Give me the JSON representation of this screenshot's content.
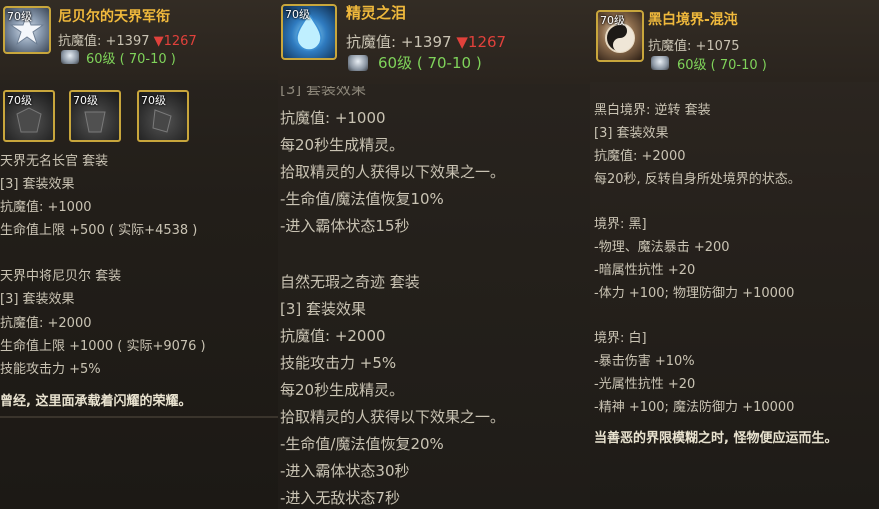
{
  "tooltips": [
    {
      "item_level": "70级",
      "name": "尼贝尔的天界军衔",
      "stat_line": "抗魔值: +1397",
      "stat_down": "▼1267",
      "req": "60级 ( 70-10 )",
      "set_slots": [
        "70级",
        "70级",
        "70级"
      ],
      "lines": [
        "天界无名长官  套装",
        "[3] 套装效果",
        "抗魔值: +1000",
        "生命值上限 +500 ( 实际+4538 )",
        "",
        "天界中将尼贝尔  套装",
        "[3] 套装效果",
        "抗魔值: +2000",
        "生命值上限 +1000 ( 实际+9076 )",
        "技能攻击力 +5%"
      ],
      "flavor": "曾经, 这里面承载着闪耀的荣耀。"
    },
    {
      "item_level": "70级",
      "name": "精灵之泪",
      "stat_line": "抗魔值: +1397",
      "stat_down": "▼1267",
      "req": "60级 ( 70-10 )",
      "partial_top": "[3] 套装效果",
      "lines": [
        "抗魔值: +1000",
        "每20秒生成精灵。",
        "拾取精灵的人获得以下效果之一。",
        "-生命值/魔法值恢复10%",
        "-进入霸体状态15秒",
        "",
        "自然无瑕之奇迹  套装",
        "[3] 套装效果",
        "抗魔值: +2000",
        "技能攻击力 +5%",
        "每20秒生成精灵。",
        "拾取精灵的人获得以下效果之一。",
        "-生命值/魔法值恢复20%",
        "-进入霸体状态30秒",
        "-进入无敌状态7秒"
      ]
    },
    {
      "item_level": "70级",
      "name": "黑白境界-混沌",
      "stat_line": "抗魔值: +1075",
      "req": "60级 ( 70-10 )",
      "lines": [
        "黑白境界: 逆转  套装",
        "[3] 套装效果",
        "抗魔值: +2000",
        "每20秒, 反转自身所处境界的状态。",
        "",
        "境界: 黑]",
        "-物理、魔法暴击 +200",
        "-暗属性抗性 +20",
        "-体力 +100; 物理防御力 +10000",
        "",
        "境界: 白]",
        "-暴击伤害 +10%",
        "-光属性抗性 +20",
        "-精神 +100; 魔法防御力 +10000"
      ],
      "flavor": "当善恶的界限模糊之时, 怪物便应运而生。"
    }
  ],
  "colors": {
    "name": "#f0b93c",
    "down": "#e0413b",
    "req": "#7fd35a",
    "border": "#c8a63c"
  },
  "icons": [
    "star-medal-icon",
    "water-drop-crystal-icon",
    "yin-yang-orb-icon",
    "gem-icon"
  ]
}
